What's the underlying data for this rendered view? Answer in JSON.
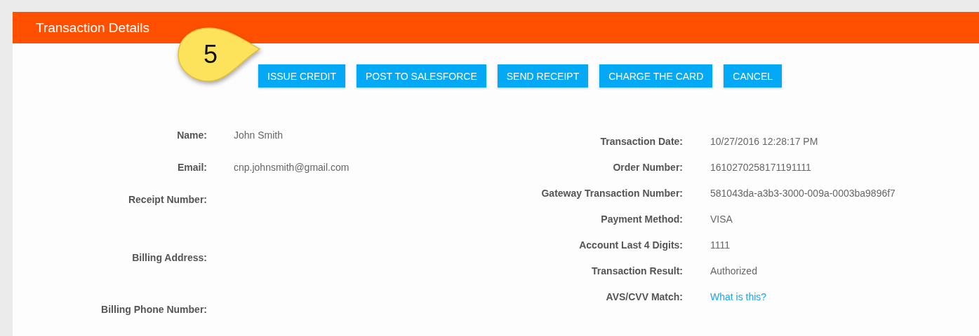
{
  "panel": {
    "title": "Transaction Details"
  },
  "callout": {
    "label": "5"
  },
  "buttons": [
    {
      "label": "ISSUE CREDIT"
    },
    {
      "label": "POST TO SALESFORCE"
    },
    {
      "label": "SEND RECEIPT"
    },
    {
      "label": "CHARGE THE CARD"
    },
    {
      "label": "CANCEL"
    }
  ],
  "left_fields": [
    {
      "label": "Name:",
      "value": "John Smith"
    },
    {
      "label": "Email:",
      "value": "cnp.johnsmith@gmail.com"
    },
    {
      "label": "Receipt Number:"
    },
    {
      "label": "Billing Address:"
    },
    {
      "label": "Billing Phone Number:"
    }
  ],
  "right_fields": [
    {
      "label": "Transaction Date:",
      "value": "10/27/2016 12:28:17 PM",
      "kind": "text"
    },
    {
      "label": "Order Number:",
      "value": "1610270258171191111",
      "kind": "text"
    },
    {
      "label": "Gateway Transaction Number:",
      "value": "581043da-a3b3-3000-009a-0003ba9896f7",
      "kind": "text"
    },
    {
      "label": "Payment Method:",
      "value": "VISA",
      "kind": "text"
    },
    {
      "label": "Account Last 4 Digits:",
      "value": "1111",
      "kind": "text"
    },
    {
      "label": "Transaction Result:",
      "value": "Authorized",
      "kind": "text"
    },
    {
      "label": "AVS/CVV Match:",
      "value": "What is this?",
      "kind": "link"
    }
  ]
}
